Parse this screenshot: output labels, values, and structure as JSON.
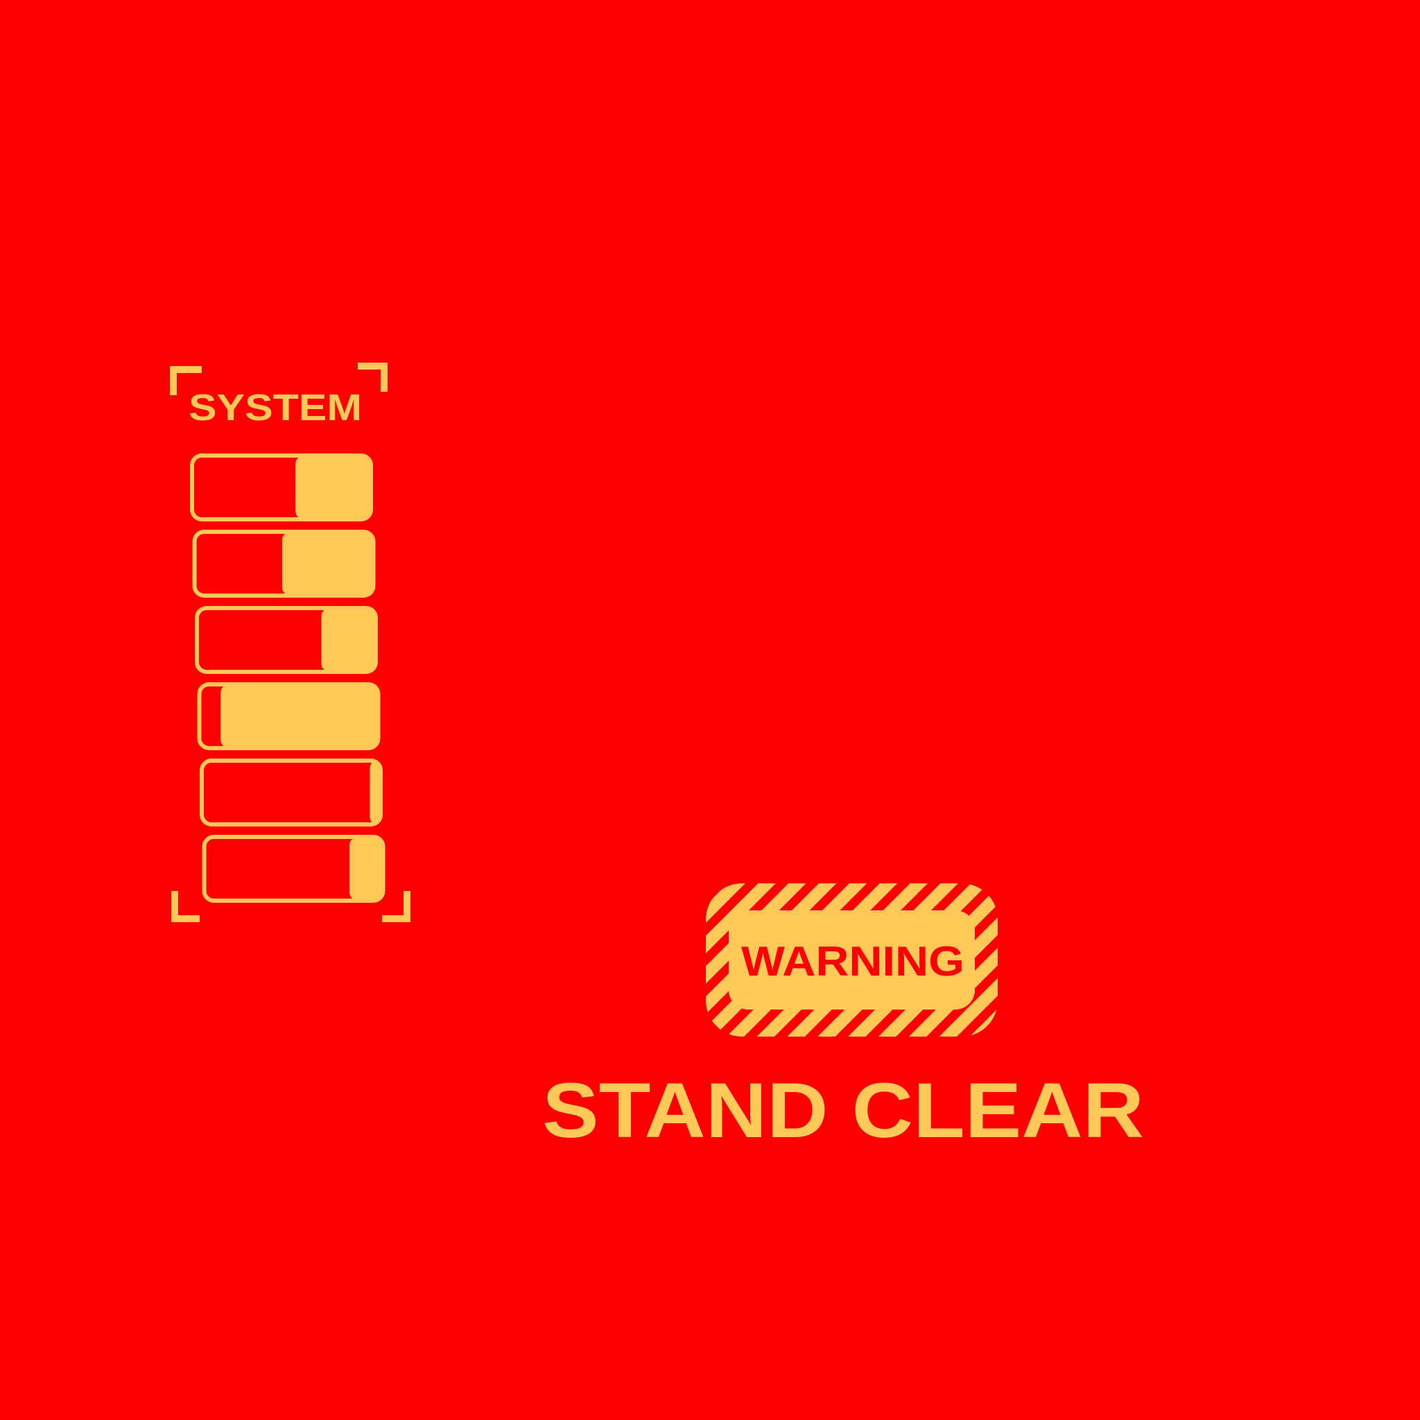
{
  "colors": {
    "background": "#ff0000",
    "accent": "#ffc857"
  },
  "system_panel": {
    "title": "SYSTEM",
    "bars": [
      {
        "level": 0.42
      },
      {
        "level": 0.51
      },
      {
        "level": 0.3
      },
      {
        "level": 0.89
      },
      {
        "level": 0.05
      },
      {
        "level": 0.18
      }
    ]
  },
  "warning_badge": {
    "label": "WARNING"
  },
  "caption": {
    "text": "STAND CLEAR"
  }
}
